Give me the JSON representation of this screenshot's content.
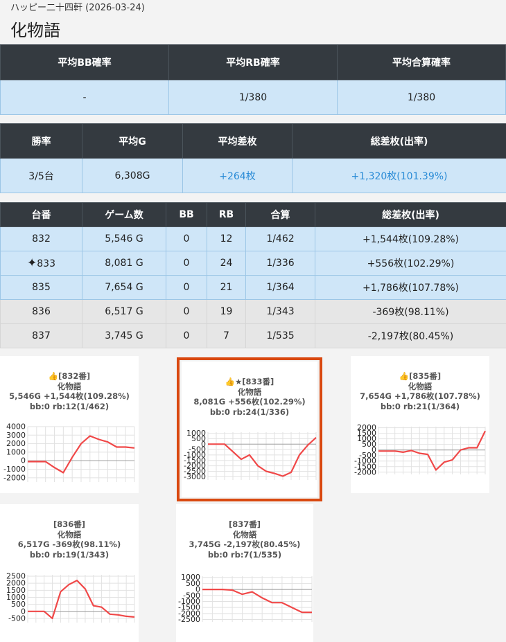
{
  "store": "ハッピー二十四軒 (2026-03-24)",
  "title": "化物語",
  "summary1": {
    "headers": [
      "平均BB確率",
      "平均RB確率",
      "平均合算確率"
    ],
    "values": [
      "-",
      "1/380",
      "1/380"
    ]
  },
  "summary2": {
    "headers": [
      "勝率",
      "平均G",
      "平均差枚",
      "総差枚(出率)"
    ],
    "values": [
      "3/5台",
      "6,308G",
      "+264枚",
      "+1,320枚(101.39%)"
    ]
  },
  "machines": {
    "headers": [
      "台番",
      "ゲーム数",
      "BB",
      "RB",
      "合算",
      "総差枚(出率)"
    ],
    "rows": [
      {
        "no": "832",
        "games": "5,546 G",
        "bb": "0",
        "rb": "12",
        "total": "1/462",
        "diff": "+1,544枚(109.28%)"
      },
      {
        "no": "833",
        "games": "8,081 G",
        "bb": "0",
        "rb": "24",
        "total": "1/336",
        "diff": "+556枚(102.29%)"
      },
      {
        "no": "835",
        "games": "7,654 G",
        "bb": "0",
        "rb": "21",
        "total": "1/364",
        "diff": "+1,786枚(107.78%)"
      },
      {
        "no": "836",
        "games": "6,517 G",
        "bb": "0",
        "rb": "19",
        "total": "1/343",
        "diff": "-369枚(98.11%)"
      },
      {
        "no": "837",
        "games": "3,745 G",
        "bb": "0",
        "rb": "7",
        "total": "1/535",
        "diff": "-2,197枚(80.45%)"
      }
    ],
    "featured_icon": "sparkles-icon"
  },
  "charts_text": [
    {
      "head": "👍[832番]",
      "name": "化物語",
      "stats": "5,546G +1,544枚(109.28%)",
      "probs": "bb:0 rb:12(1/462)"
    },
    {
      "head": "👍★[833番]",
      "name": "化物語",
      "stats": "8,081G +556枚(102.29%)",
      "probs": "bb:0 rb:24(1/336)"
    },
    {
      "head": "👍[835番]",
      "name": "化物語",
      "stats": "7,654G +1,786枚(107.78%)",
      "probs": "bb:0 rb:21(1/364)"
    },
    {
      "head": "[836番]",
      "name": "化物語",
      "stats": "6,517G -369枚(98.11%)",
      "probs": "bb:0 rb:19(1/343)"
    },
    {
      "head": "[837番]",
      "name": "化物語",
      "stats": "3,745G -2,197枚(80.45%)",
      "probs": "bb:0 rb:7(1/535)"
    }
  ],
  "colors": {
    "line": "#f04848",
    "highlight": "#d9480f",
    "header_bg": "#343a40",
    "row_blue": "#cfe6f8",
    "row_gray": "#e6e6e6",
    "positive": "#2a8bd6"
  },
  "chart_data": [
    {
      "type": "line",
      "ylim": [
        -2500,
        4000
      ],
      "yticks": [
        "4000",
        "3000",
        "2000",
        "1000",
        "0",
        "-1000",
        "-2000"
      ],
      "values": [
        -100,
        -100,
        -100,
        -800,
        -1400,
        400,
        2000,
        2900,
        2500,
        2200,
        1600,
        1600,
        1500
      ]
    },
    {
      "type": "line",
      "ylim": [
        -3300,
        1100
      ],
      "yticks": [
        "1000",
        "500",
        "0",
        "-500",
        "-1000",
        "-1500",
        "-2000",
        "-2500",
        "-3000"
      ],
      "values": [
        0,
        0,
        0,
        -700,
        -1400,
        -1000,
        -2000,
        -2500,
        -2700,
        -2950,
        -2600,
        -1000,
        -100,
        600
      ]
    },
    {
      "type": "line",
      "ylim": [
        -2200,
        2100
      ],
      "yticks": [
        "2000",
        "1500",
        "1000",
        "500",
        "0",
        "-500",
        "-1000",
        "-1500",
        "-2000"
      ],
      "values": [
        -100,
        -100,
        -100,
        -200,
        -50,
        -300,
        -400,
        -1800,
        -1100,
        -900,
        0,
        200,
        200,
        1700
      ]
    },
    {
      "type": "line",
      "ylim": [
        -800,
        2600
      ],
      "yticks": [
        "2500",
        "2000",
        "1500",
        "1000",
        "500",
        "0",
        "-500"
      ],
      "values": [
        0,
        0,
        0,
        -500,
        1400,
        1900,
        2200,
        1600,
        400,
        300,
        -200,
        -250,
        -350,
        -400
      ]
    },
    {
      "type": "line",
      "ylim": [
        -2700,
        1100
      ],
      "yticks": [
        "1000",
        "500",
        "0",
        "-500",
        "-1000",
        "-1500",
        "-2000",
        "-2500"
      ],
      "values": [
        0,
        0,
        0,
        -50,
        -400,
        -200,
        -700,
        -1100,
        -1100,
        -1500,
        -1900,
        -1900
      ]
    }
  ]
}
